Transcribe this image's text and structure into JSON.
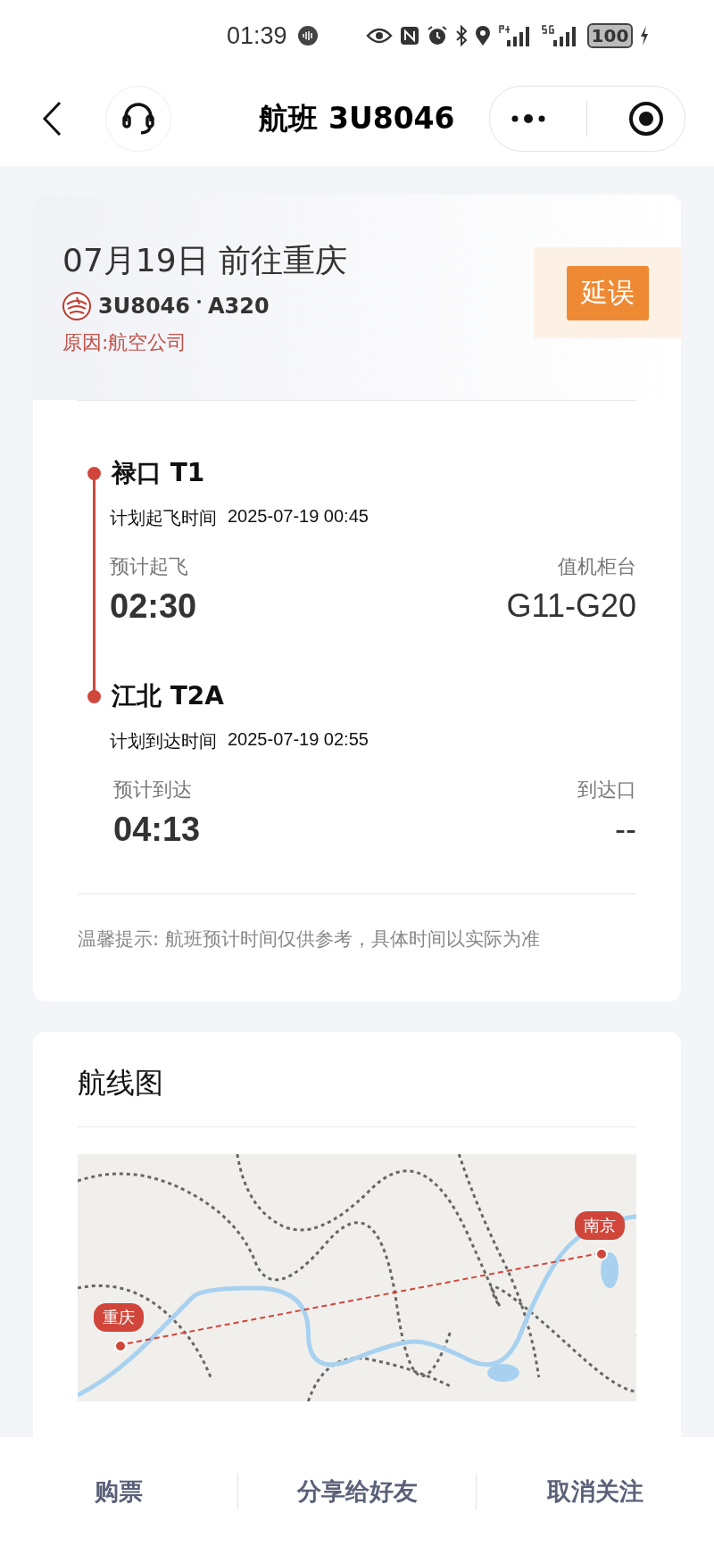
{
  "status_bar": {
    "time": "01:39",
    "battery": "100"
  },
  "nav": {
    "title": "航班 3U8046"
  },
  "flight": {
    "title": "07月19日 前往重庆",
    "flight_no": "3U8046",
    "aircraft": "A320",
    "reason": "原因:航空公司",
    "status": "延误",
    "stops": [
      {
        "kind": "departure",
        "name": "禄口 T1",
        "planned_label": "计划起飞时间",
        "planned_time": "2025-07-19 00:45",
        "est_label": "预计起飞",
        "est_time": "02:30",
        "extra_label": "值机柜台",
        "extra_value": "G11-G20"
      },
      {
        "kind": "arrival",
        "name": "江北 T2A",
        "planned_label": "计划到达时间",
        "planned_time": "2025-07-19 02:55",
        "est_label": "预计到达",
        "est_time": "04:13",
        "extra_label": "到达口",
        "extra_value": "--"
      }
    ],
    "tip": "温馨提示: 航班预计时间仅供参考，具体时间以实际为准"
  },
  "route_map": {
    "title": "航线图",
    "pins": [
      {
        "label": "重庆"
      },
      {
        "label": "南京"
      }
    ]
  },
  "bottom_bar": {
    "buttons": [
      "购票",
      "分享给好友",
      "取消关注"
    ]
  }
}
